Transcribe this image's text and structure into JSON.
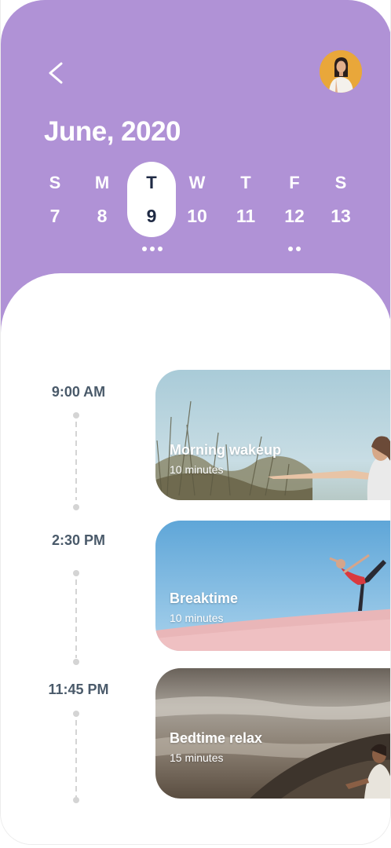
{
  "header": {
    "month_title": "June, 2020",
    "back_icon": "chevron-left-icon",
    "avatar": "user-avatar"
  },
  "week": {
    "days": [
      {
        "dow": "S",
        "num": "7",
        "selected": false
      },
      {
        "dow": "M",
        "num": "8",
        "selected": false
      },
      {
        "dow": "T",
        "num": "9",
        "selected": true
      },
      {
        "dow": "W",
        "num": "10",
        "selected": false
      },
      {
        "dow": "T",
        "num": "11",
        "selected": false
      },
      {
        "dow": "F",
        "num": "12",
        "selected": false
      },
      {
        "dow": "S",
        "num": "13",
        "selected": false
      }
    ],
    "event_dots": {
      "tuesday": 3,
      "friday": 2
    }
  },
  "schedule": [
    {
      "time": "9:00 AM",
      "title": "Morning wakeup",
      "duration": "10 minutes"
    },
    {
      "time": "2:30 PM",
      "title": "Breaktime",
      "duration": "10 minutes"
    },
    {
      "time": "11:45 PM",
      "title": "Bedtime relax",
      "duration": "15 minutes"
    }
  ],
  "colors": {
    "header_bg": "#b092d6",
    "selected_text": "#1f2a44",
    "time_text": "#4a5a6a",
    "timeline": "#d4d4d4"
  }
}
